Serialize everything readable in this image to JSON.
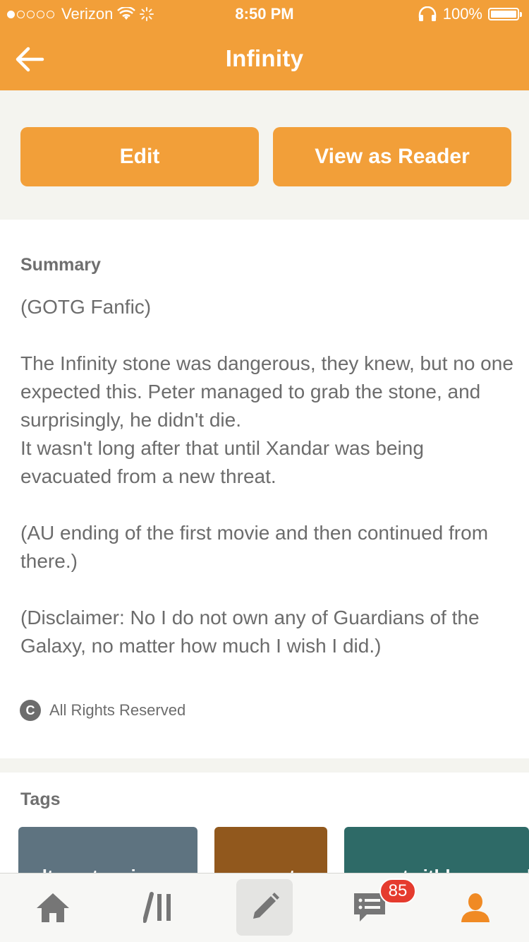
{
  "status_bar": {
    "carrier": "Verizon",
    "time": "8:50 PM",
    "battery_percent": "100%"
  },
  "nav": {
    "title": "Infinity"
  },
  "actions": {
    "edit_label": "Edit",
    "reader_label": "View as Reader"
  },
  "summary": {
    "heading": "Summary",
    "paragraphs": [
      "(GOTG Fanfic)",
      "The Infinity stone was dangerous, they knew, but no one expected this. Peter managed to grab the stone, and surprisingly, he didn't die.\nIt wasn't long after that until Xandar was being evacuated from a new threat.",
      "(AU ending of the first movie and then continued from there.)",
      "(Disclaimer: No I do not own any of Guardians of the Galaxy, no matter how much I wish I did.)"
    ],
    "rights": "All Rights Reserved"
  },
  "tags": {
    "heading": "Tags",
    "items": [
      {
        "label": "alternateuniverse",
        "color": "#5e7380"
      },
      {
        "label": "angst",
        "color": "#91581d"
      },
      {
        "label": "angstwithhappyending",
        "color": "#2e6a67"
      }
    ]
  },
  "tab_bar": {
    "items": [
      {
        "name": "home-icon"
      },
      {
        "name": "library-icon"
      },
      {
        "name": "write-icon",
        "active": true
      },
      {
        "name": "messages-icon"
      },
      {
        "name": "profile-icon"
      }
    ],
    "notification_count": "85"
  },
  "colors": {
    "brand": "#f29f39",
    "badge": "#e53b2e"
  }
}
